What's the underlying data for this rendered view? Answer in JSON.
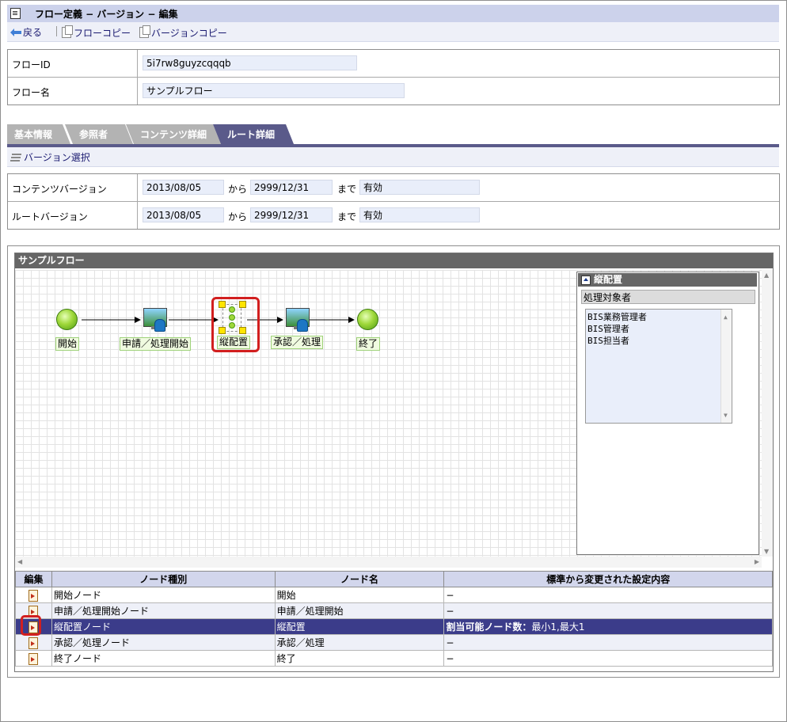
{
  "header": {
    "title": "フロー定義 − バージョン − 編集",
    "toolbar": {
      "back": "戻る",
      "flow_copy": "フローコピー",
      "version_copy": "バージョンコピー"
    }
  },
  "flow_info": {
    "id_label": "フローID",
    "id_value": "5i7rw8guyzcqqqb",
    "name_label": "フロー名",
    "name_value": "サンプルフロー"
  },
  "tabs": [
    "基本情報",
    "参照者",
    "コンテンツ詳細",
    "ルート詳細"
  ],
  "active_tab": "ルート詳細",
  "subtoolbar": {
    "version_select": "バージョン選択"
  },
  "versions": {
    "from_word": "から",
    "to_word": "まで",
    "content": {
      "label": "コンテンツバージョン",
      "start": "2013/08/05",
      "end": "2999/12/31",
      "status": "有効"
    },
    "route": {
      "label": "ルートバージョン",
      "start": "2013/08/05",
      "end": "2999/12/31",
      "status": "有効"
    }
  },
  "flow": {
    "title": "サンプルフロー",
    "nodes": [
      "開始",
      "申請／処理開始",
      "縦配置",
      "承認／処理",
      "終了"
    ]
  },
  "side_panel": {
    "title": "縦配置",
    "subtitle": "処理対象者",
    "items": [
      "BIS業務管理者",
      "BIS管理者",
      "BIS担当者"
    ]
  },
  "node_table": {
    "headers": [
      "編集",
      "ノード種別",
      "ノード名",
      "標準から変更された設定内容"
    ],
    "rows": [
      {
        "type": "開始ノード",
        "name": "開始",
        "setting": "−"
      },
      {
        "type": "申請／処理開始ノード",
        "name": "申請／処理開始",
        "setting": "−"
      },
      {
        "type": "縦配置ノード",
        "name": "縦配置",
        "setting_label": "割当可能ノード数：",
        "setting": "最小1,最大1"
      },
      {
        "type": "承認／処理ノード",
        "name": "承認／処理",
        "setting": "−"
      },
      {
        "type": "終了ノード",
        "name": "終了",
        "setting": "−"
      }
    ]
  },
  "colors": {
    "accent": "#5a5a8a",
    "selected_row": "#3b3c8a",
    "highlight": "#d21f1f",
    "header_bg": "#ccd2eb"
  }
}
